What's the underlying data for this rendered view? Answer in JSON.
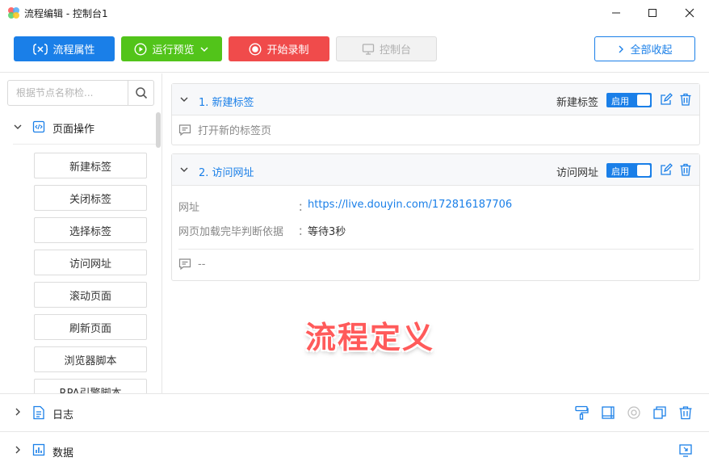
{
  "window": {
    "title": "流程编辑 - 控制台1",
    "minimize_icon": "minimize-icon",
    "maximize_icon": "maximize-icon",
    "close_icon": "close-icon"
  },
  "toolbar": {
    "props_label": "流程属性",
    "run_label": "运行预览",
    "record_label": "开始录制",
    "console_label": "控制台",
    "collapse_label": "全部收起",
    "colors": {
      "blue": "#1a7fe8",
      "green": "#52c41a",
      "red": "#f04b4b",
      "disabled": "#f2f2f2"
    }
  },
  "sidebar": {
    "search_placeholder": "根据节点名称检...",
    "category": "页面操作",
    "nodes": [
      "新建标签",
      "关闭标签",
      "选择标签",
      "访问网址",
      "滚动页面",
      "刷新页面",
      "浏览器脚本",
      "RPA引擎脚本"
    ]
  },
  "steps": [
    {
      "title": "1. 新建标签",
      "type": "新建标签",
      "toggle": "启用",
      "comment": "打开新的标签页"
    },
    {
      "title": "2. 访问网址",
      "type": "访问网址",
      "toggle": "启用",
      "props": [
        {
          "label": "网址",
          "colon": "：",
          "value": "https://live.douyin.com/172816187706"
        },
        {
          "label": "网页加载完毕判断依据",
          "colon": "：",
          "value": "等待3秒"
        }
      ],
      "comment": "--"
    }
  ],
  "overlay_text": "流程定义",
  "bottom": {
    "log_label": "日志",
    "data_label": "数据"
  }
}
